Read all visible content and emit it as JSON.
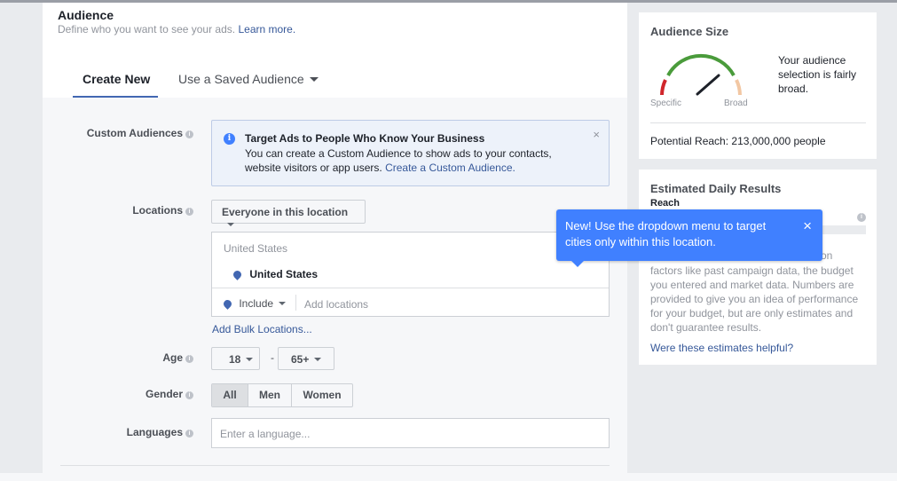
{
  "audience": {
    "title": "Audience",
    "subtitle": "Define who you want to see your ads.",
    "learn_more": "Learn more."
  },
  "tabs": {
    "create_new": "Create New",
    "saved": "Use a Saved Audience"
  },
  "custom_audiences": {
    "label": "Custom Audiences",
    "info_title": "Target Ads to People Who Know Your Business",
    "info_body": "You can create a Custom Audience to show ads to your contacts, website visitors or app users.",
    "info_link": "Create a Custom Audience."
  },
  "locations": {
    "label": "Locations",
    "dropdown": "Everyone in this location",
    "list_header": "United States",
    "selected": "United States",
    "include": "Include",
    "add_placeholder": "Add locations",
    "bulk_link": "Add Bulk Locations..."
  },
  "tooltip": {
    "text": "New! Use the dropdown menu to target cities only within this location.",
    "close": "×"
  },
  "age": {
    "label": "Age",
    "min": "18",
    "separator": "-",
    "max": "65+"
  },
  "gender": {
    "label": "Gender",
    "options": [
      "All",
      "Men",
      "Women"
    ],
    "selected": "All"
  },
  "languages": {
    "label": "Languages",
    "placeholder": "Enter a language..."
  },
  "audience_size": {
    "title": "Audience Size",
    "specific": "Specific",
    "broad": "Broad",
    "description": "Your audience selection is fairly broad.",
    "potential_reach": "Potential Reach: 213,000,000 people",
    "colors": {
      "low": "#d0262b",
      "mid": "#4a9b3b",
      "high": "#f2c7a3"
    }
  },
  "daily_results": {
    "title": "Estimated Daily Results",
    "reach": "Reach",
    "body_partial": "on",
    "body": "factors like past campaign data, the budget you entered and market data. Numbers are provided to give you an idea of performance for your budget, but are only estimates and don't guarantee results.",
    "helpful_link": "Were these estimates helpful?"
  },
  "colors": {
    "link": "#365899",
    "tooltip_bg": "#4080ff",
    "info_box_bg": "#edf2fa",
    "tab_underline": "#4267b2"
  }
}
